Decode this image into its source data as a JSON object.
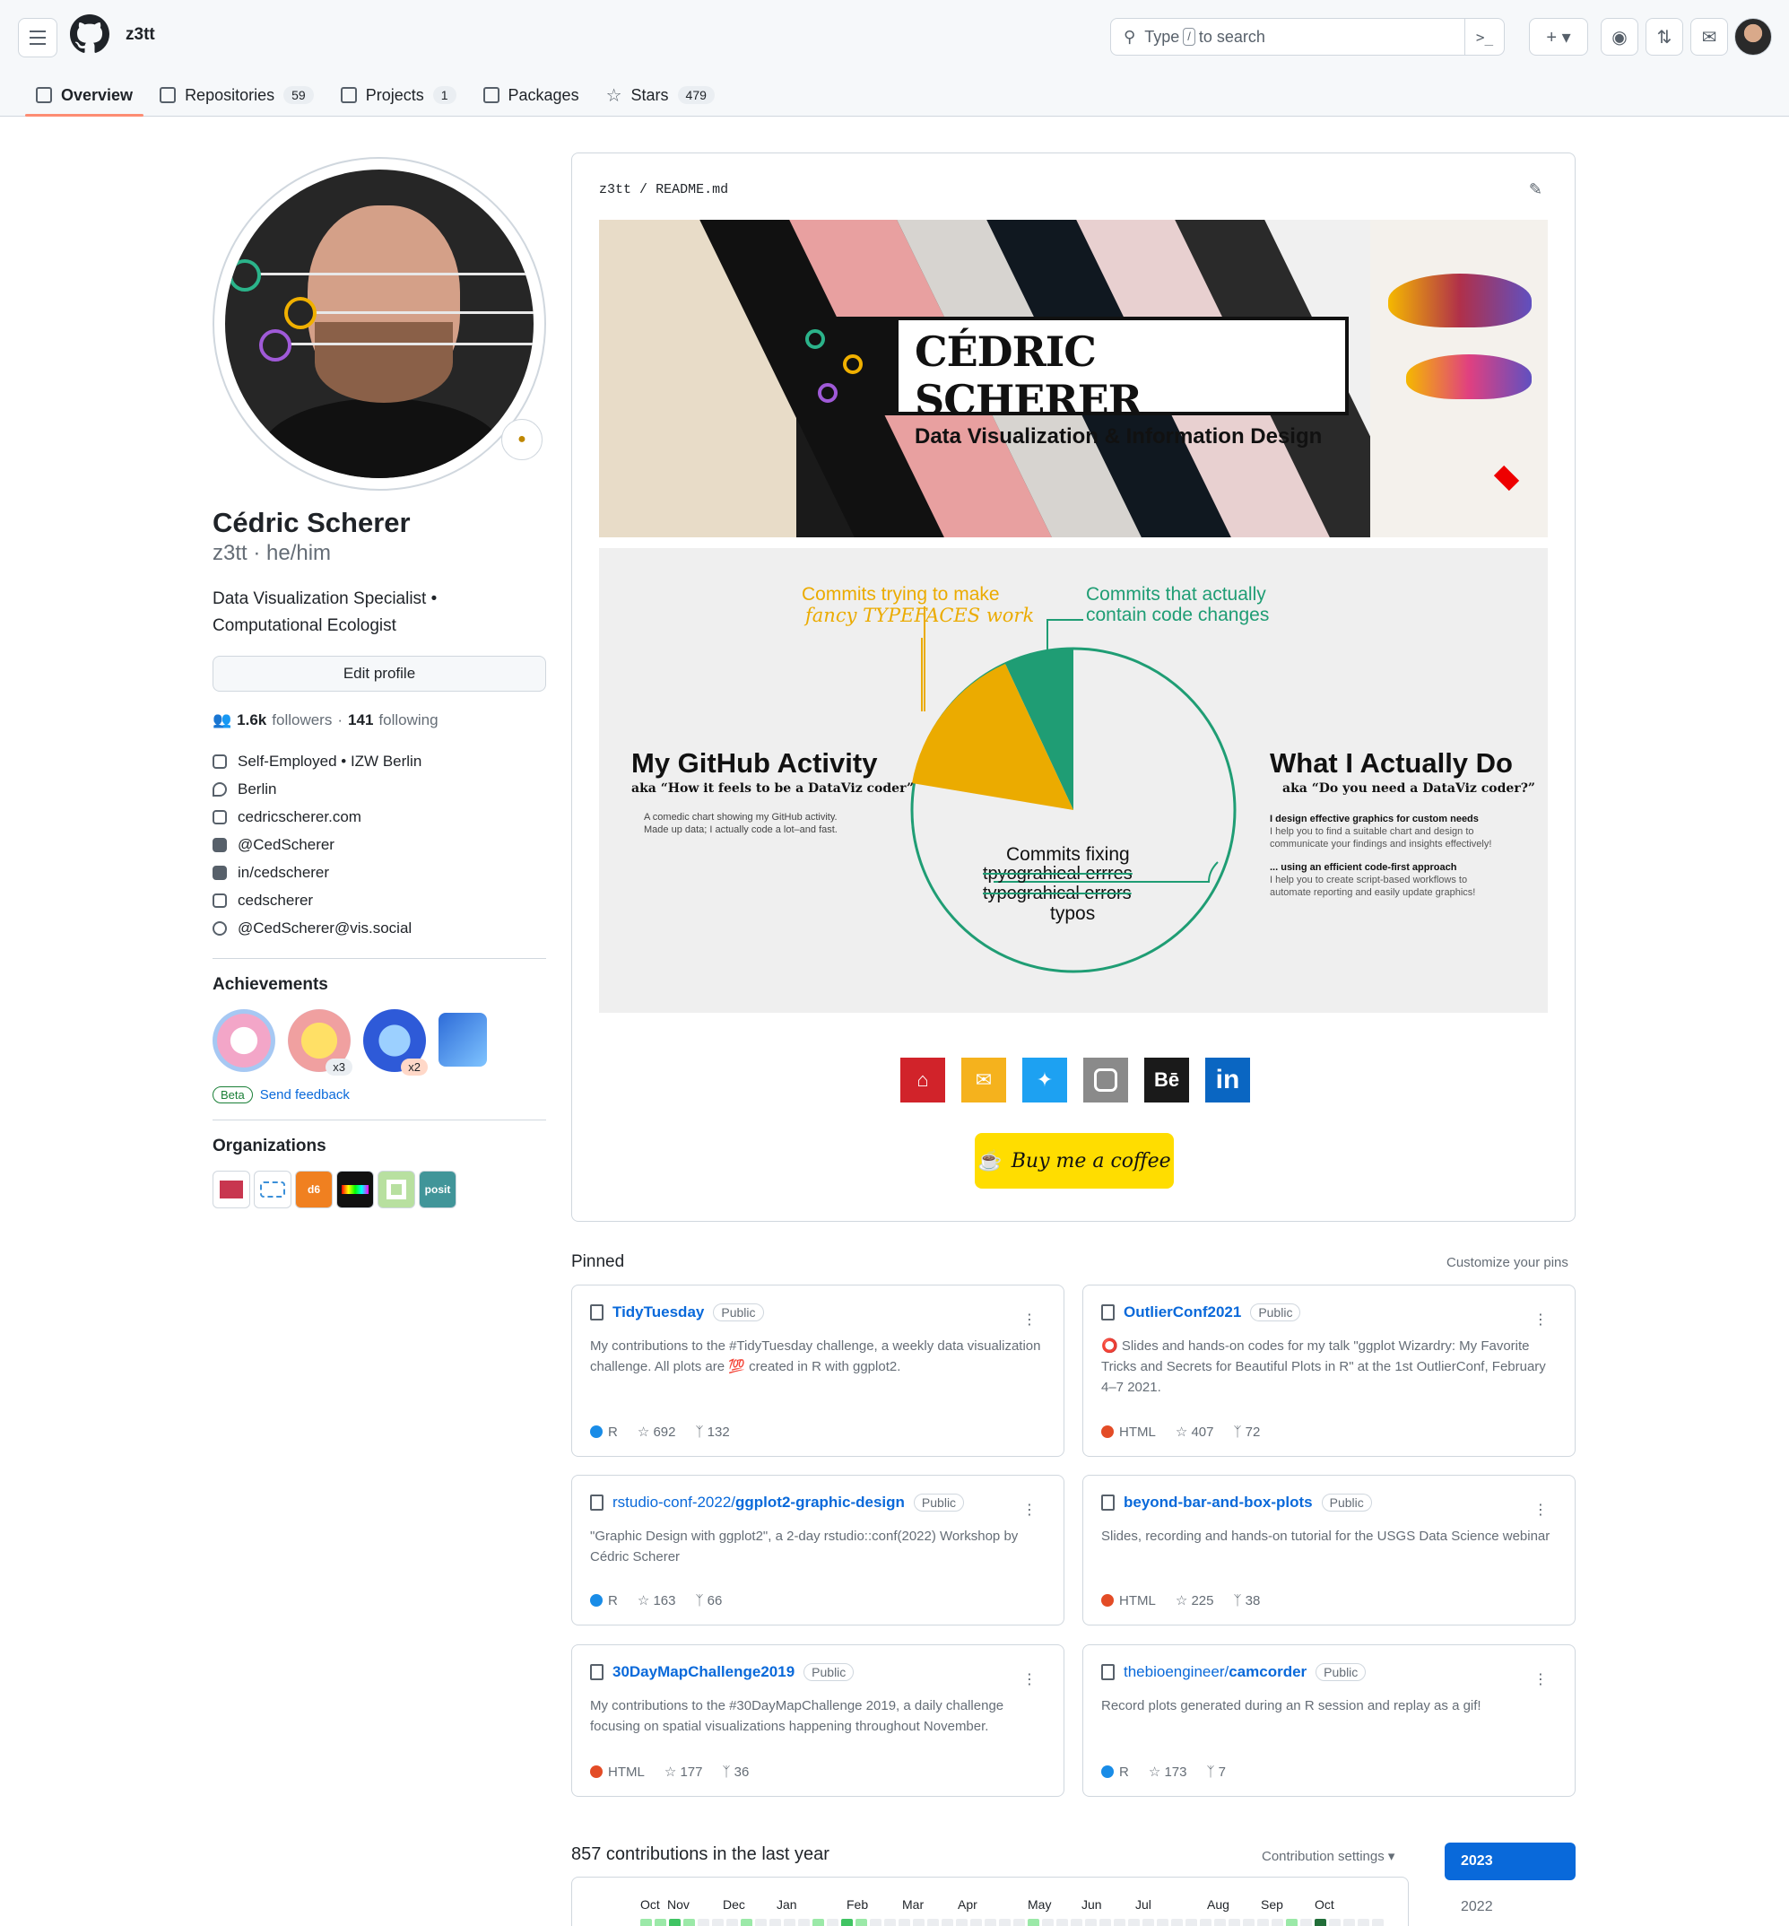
{
  "header": {
    "username": "z3tt",
    "search_prefix": "Type",
    "search_key": "/",
    "search_suffix": "to search",
    "plus": "+ ▾"
  },
  "tabs": [
    {
      "label": "Overview",
      "count": ""
    },
    {
      "label": "Repositories",
      "count": "59"
    },
    {
      "label": "Projects",
      "count": "1"
    },
    {
      "label": "Packages",
      "count": ""
    },
    {
      "label": "Stars",
      "count": "479"
    }
  ],
  "profile": {
    "name": "Cédric Scherer",
    "login": "z3tt · he/him",
    "bio_line1": "Data Visualization Specialist •",
    "bio_line2": "Computational Ecologist",
    "edit_button": "Edit profile",
    "followers_count": "1.6k",
    "followers_label": "followers",
    "separator": "·",
    "following_count": "141",
    "following_label": "following",
    "details": [
      {
        "icon": "organization-icon",
        "text": "Self-Employed • IZW Berlin"
      },
      {
        "icon": "location-icon",
        "text": "Berlin"
      },
      {
        "icon": "link-icon",
        "text": "cedricscherer.com"
      },
      {
        "icon": "twitter-icon",
        "text": "@CedScherer"
      },
      {
        "icon": "linkedin-icon",
        "text": "in/cedscherer"
      },
      {
        "icon": "instagram-icon",
        "text": "cedscherer"
      },
      {
        "icon": "mastodon-icon",
        "text": "@CedScherer@vis.social"
      }
    ]
  },
  "achievements": {
    "title": "Achievements",
    "badges": [
      {
        "name": "yolo-badge",
        "mult": ""
      },
      {
        "name": "pull-shark-badge",
        "mult": "x3"
      },
      {
        "name": "starstruck-badge",
        "mult": "x2"
      },
      {
        "name": "arctic-code-vault-badge",
        "mult": ""
      }
    ],
    "beta": "Beta",
    "feedback": "Send feedback"
  },
  "organizations": {
    "title": "Organizations",
    "items": [
      "",
      "",
      "d6",
      "",
      "",
      "posit"
    ]
  },
  "readme": {
    "path_user": "z3tt",
    "path_sep": "/",
    "path_file": "README.md",
    "banner_title": "CÉDRIC SCHERER",
    "banner_subtitle": "Data Visualization & Information Design",
    "activity": {
      "left_title": "My GitHub Activity",
      "left_subtitle": "aka “How it feels to be a DataViz coder”",
      "left_note_1": "A comedic chart showing my GitHub activity.",
      "left_note_2": "Made up data; I actually code a lot–and fast.",
      "right_title": "What I Actually Do",
      "right_subtitle": "aka “Do you need a DataViz coder?”",
      "right_h1": "I design effective graphics for custom needs",
      "right_p1a": "I help you to find a suitable chart and design to",
      "right_p1b": "communicate your findings and insights effectively!",
      "right_h2": "... using an efficient code-first approach",
      "right_p2a": "I help you to create script-based workflows to",
      "right_p2b": "automate reporting and easily update graphics!",
      "label_yellow_1": "Commits trying to make",
      "label_yellow_2": "fancy TYPEFACES work",
      "label_green_1": "Commits that actually",
      "label_green_2": "contain code changes",
      "label_pie_1": "Commits fixing",
      "label_pie_2": "tpyograhieal errres",
      "label_pie_3": "typograhical errors",
      "label_pie_4": "typos"
    },
    "social": [
      "home-icon",
      "mail-icon",
      "twitter-icon",
      "instagram-icon",
      "behance-icon",
      "linkedin-icon"
    ],
    "behance_text": "Bē",
    "linkedin_text": "in",
    "coffee": "Buy me a coffee"
  },
  "pinned": {
    "title": "Pinned",
    "customize": "Customize your pins",
    "repos": [
      {
        "name_prefix": "",
        "name": "TidyTuesday",
        "visibility": "Public",
        "desc": "My contributions to the #TidyTuesday challenge, a weekly data visualization challenge. All plots are 💯 created in R with ggplot2.",
        "lang": "R",
        "lang_color": "#198ce7",
        "stars": "692",
        "forks": "132"
      },
      {
        "name_prefix": "",
        "name": "OutlierConf2021",
        "visibility": "Public",
        "desc": "⭕ Slides and hands-on codes for my talk \"ggplot Wizardry: My Favorite Tricks and Secrets for Beautiful Plots in R\" at the 1st OutlierConf, February 4–7 2021.",
        "lang": "HTML",
        "lang_color": "#e34c26",
        "stars": "407",
        "forks": "72"
      },
      {
        "name_prefix": "rstudio-conf-2022/",
        "name": "ggplot2-graphic-design",
        "visibility": "Public",
        "desc": "\"Graphic Design with ggplot2\", a 2-day rstudio::conf(2022) Workshop by Cédric Scherer",
        "lang": "R",
        "lang_color": "#198ce7",
        "stars": "163",
        "forks": "66"
      },
      {
        "name_prefix": "",
        "name": "beyond-bar-and-box-plots",
        "visibility": "Public",
        "desc": "Slides, recording and hands-on tutorial for the USGS Data Science webinar",
        "lang": "HTML",
        "lang_color": "#e34c26",
        "stars": "225",
        "forks": "38"
      },
      {
        "name_prefix": "",
        "name": "30DayMapChallenge2019",
        "visibility": "Public",
        "desc": "My contributions to the #30DayMapChallenge 2019, a daily challenge focusing on spatial visualizations happening throughout November.",
        "lang": "HTML",
        "lang_color": "#e34c26",
        "stars": "177",
        "forks": "36"
      },
      {
        "name_prefix": "thebioengineer/",
        "name": "camcorder",
        "visibility": "Public",
        "desc": "Record plots generated during an R session and replay as a gif!",
        "lang": "R",
        "lang_color": "#198ce7",
        "stars": "173",
        "forks": "7"
      }
    ]
  },
  "contributions": {
    "title": "857 contributions in the last year",
    "settings": "Contribution settings ▾",
    "months": [
      "Oct",
      "Nov",
      "Dec",
      "Jan",
      "Feb",
      "Mar",
      "Apr",
      "May",
      "Jun",
      "Jul",
      "Aug",
      "Sep",
      "Oct"
    ],
    "years": [
      "2023",
      "2022"
    ]
  },
  "colors": {
    "accent": "#0969da",
    "tab_underline": "#fd8c73",
    "green": "#1f9d74",
    "yellow": "#ebab00"
  }
}
